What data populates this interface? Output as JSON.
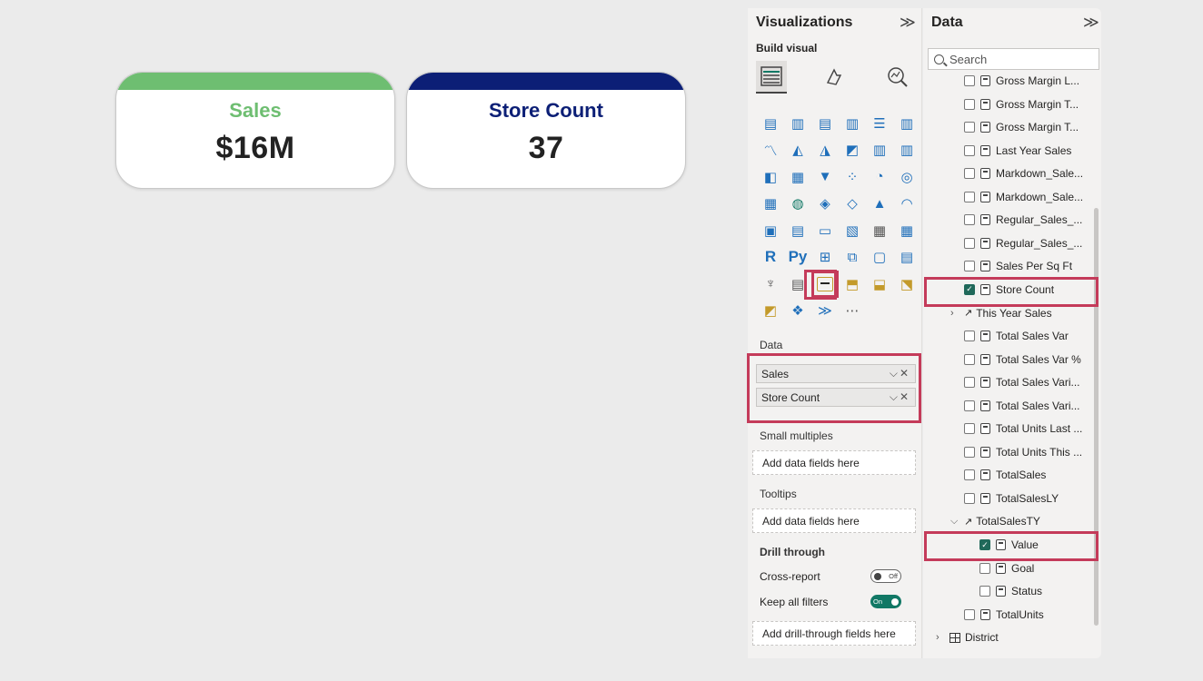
{
  "cards": [
    {
      "title": "Sales",
      "value": "$16M",
      "color": "#6ebe71"
    },
    {
      "title": "Store Count",
      "value": "37",
      "color": "#0c1f76"
    }
  ],
  "viz": {
    "title": "Visualizations",
    "build_visual_label": "Build visual",
    "data_section_label": "Data",
    "wells": [
      "Sales",
      "Store Count"
    ],
    "small_multiples_label": "Small multiples",
    "small_multiples_placeholder": "Add data fields here",
    "tooltips_label": "Tooltips",
    "tooltips_placeholder": "Add data fields here",
    "drill_through_label": "Drill through",
    "cross_report_label": "Cross-report",
    "cross_report_state": "Off",
    "keep_filters_label": "Keep all filters",
    "keep_filters_state": "On",
    "drill_placeholder": "Add drill-through fields here",
    "selected_visual": "kpi-icon"
  },
  "data_panel": {
    "title": "Data",
    "search_placeholder": "Search",
    "fields": [
      {
        "label": "Gross Margin L...",
        "kind": "measure",
        "checked": false
      },
      {
        "label": "Gross Margin T...",
        "kind": "measure",
        "checked": false
      },
      {
        "label": "Gross Margin T...",
        "kind": "measure",
        "checked": false
      },
      {
        "label": "Last Year Sales",
        "kind": "measure",
        "checked": false
      },
      {
        "label": "Markdown_Sale...",
        "kind": "measure",
        "checked": false
      },
      {
        "label": "Markdown_Sale...",
        "kind": "measure",
        "checked": false
      },
      {
        "label": "Regular_Sales_...",
        "kind": "measure",
        "checked": false
      },
      {
        "label": "Regular_Sales_...",
        "kind": "measure",
        "checked": false
      },
      {
        "label": "Sales Per Sq Ft",
        "kind": "measure",
        "checked": false
      },
      {
        "label": "Store Count",
        "kind": "measure",
        "checked": true
      },
      {
        "label": "This Year Sales",
        "kind": "kpi-collapsed",
        "checked": false
      },
      {
        "label": "Total Sales Var",
        "kind": "measure",
        "checked": false
      },
      {
        "label": "Total Sales Var %",
        "kind": "measure",
        "checked": false
      },
      {
        "label": "Total Sales Vari...",
        "kind": "measure",
        "checked": false
      },
      {
        "label": "Total Sales Vari...",
        "kind": "measure",
        "checked": false
      },
      {
        "label": "Total Units Last ...",
        "kind": "measure",
        "checked": false
      },
      {
        "label": "Total Units This ...",
        "kind": "measure",
        "checked": false
      },
      {
        "label": "TotalSales",
        "kind": "measure",
        "checked": false
      },
      {
        "label": "TotalSalesLY",
        "kind": "measure",
        "checked": false
      },
      {
        "label": "TotalSalesTY",
        "kind": "kpi-expanded",
        "checked": false
      },
      {
        "label": "Value",
        "kind": "child",
        "checked": true
      },
      {
        "label": "Goal",
        "kind": "child",
        "checked": false
      },
      {
        "label": "Status",
        "kind": "child",
        "checked": false
      },
      {
        "label": "TotalUnits",
        "kind": "measure",
        "checked": false
      },
      {
        "label": "District",
        "kind": "table",
        "checked": false
      }
    ]
  }
}
